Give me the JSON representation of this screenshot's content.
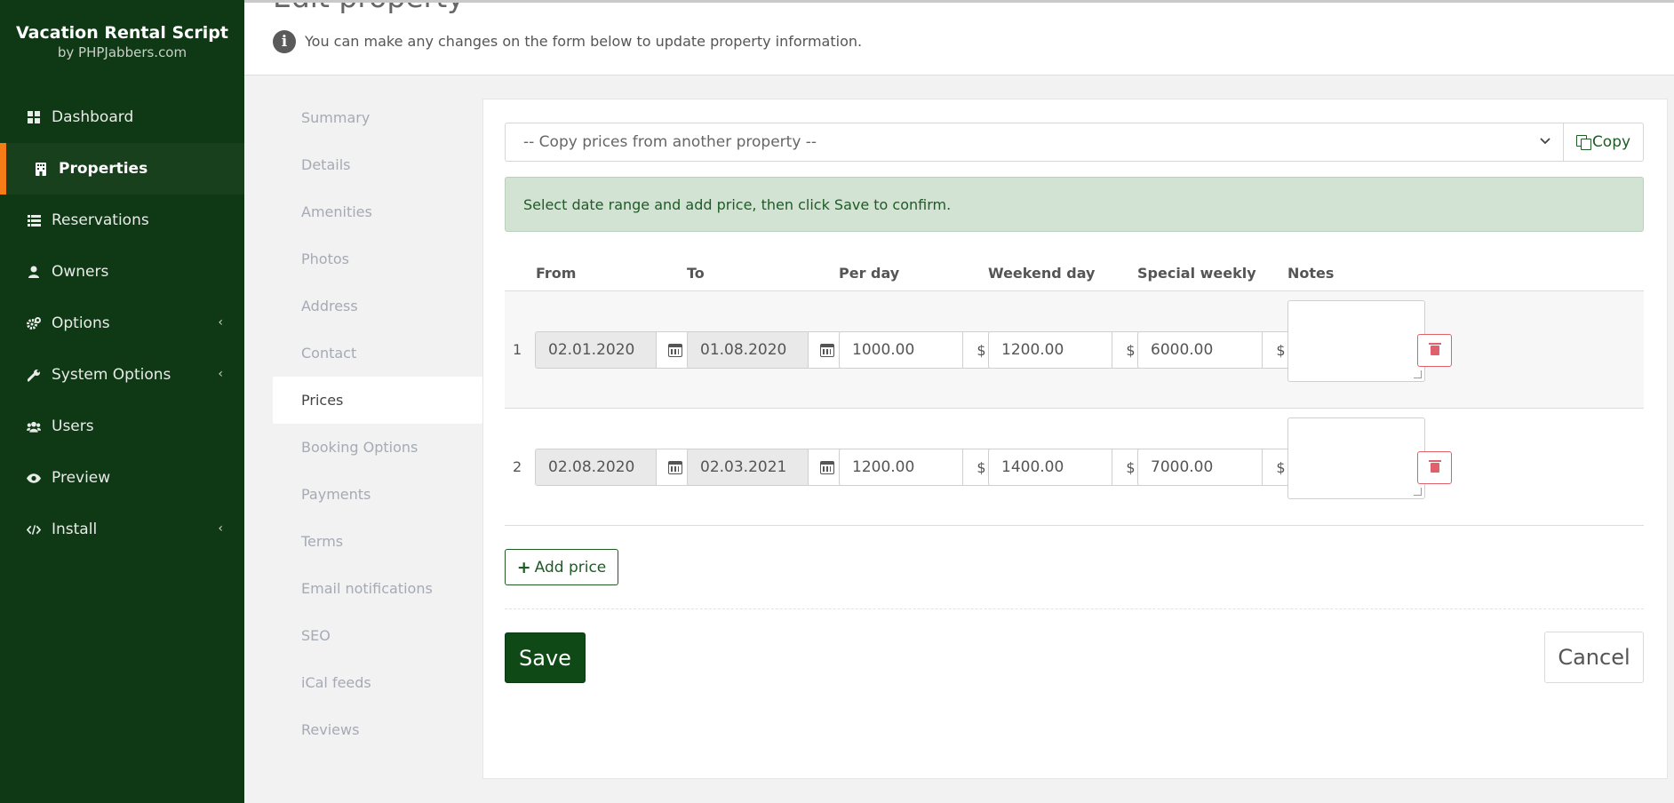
{
  "brand": {
    "title": "Vacation Rental Script",
    "subtitle": "by PHPJabbers.com"
  },
  "sidebar": {
    "items": [
      {
        "label": "Dashboard",
        "icon": "dashboard-icon"
      },
      {
        "label": "Properties",
        "icon": "building-icon",
        "active": true
      },
      {
        "label": "Reservations",
        "icon": "list-icon"
      },
      {
        "label": "Owners",
        "icon": "user-icon"
      },
      {
        "label": "Options",
        "icon": "cogs-icon",
        "caret": true
      },
      {
        "label": "System Options",
        "icon": "wrench-icon",
        "caret": true
      },
      {
        "label": "Users",
        "icon": "users-icon"
      },
      {
        "label": "Preview",
        "icon": "eye-icon"
      },
      {
        "label": "Install",
        "icon": "code-icon",
        "caret": true
      }
    ],
    "caret": "‹"
  },
  "header": {
    "title": "Edit property",
    "info": "You can make any changes on the form below to update property information.",
    "info_icon": "i"
  },
  "tabs": [
    {
      "label": "Summary"
    },
    {
      "label": "Details"
    },
    {
      "label": "Amenities"
    },
    {
      "label": "Photos"
    },
    {
      "label": "Address"
    },
    {
      "label": "Contact"
    },
    {
      "label": "Prices",
      "active": true
    },
    {
      "label": "Booking Options"
    },
    {
      "label": "Payments"
    },
    {
      "label": "Terms"
    },
    {
      "label": "Email notifications"
    },
    {
      "label": "SEO"
    },
    {
      "label": "iCal feeds"
    },
    {
      "label": "Reviews"
    }
  ],
  "copy": {
    "placeholder": "-- Copy prices from another property --",
    "button": "Copy"
  },
  "alert": "Select date range and add price, then click Save to confirm.",
  "table": {
    "headers": {
      "from": "From",
      "to": "To",
      "per_day": "Per day",
      "weekend": "Weekend day",
      "weekly": "Special weekly",
      "notes": "Notes"
    },
    "currency": "$",
    "rows": [
      {
        "num": "1",
        "from": "02.01.2020",
        "to": "01.08.2020",
        "per_day": "1000.00",
        "weekend": "1200.00",
        "weekly": "6000.00",
        "notes": ""
      },
      {
        "num": "2",
        "from": "02.08.2020",
        "to": "02.03.2021",
        "per_day": "1200.00",
        "weekend": "1400.00",
        "weekly": "7000.00",
        "notes": ""
      }
    ]
  },
  "actions": {
    "add_price": "Add price",
    "add_icon": "+",
    "save": "Save",
    "cancel": "Cancel"
  },
  "colors": {
    "sidebar": "#0f3815",
    "accent": "#f57c16",
    "primary": "#0f4a16",
    "danger": "#e0606b",
    "alert_bg": "#d2e3d4"
  }
}
